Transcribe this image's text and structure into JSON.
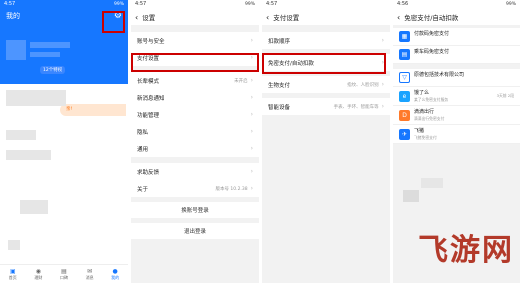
{
  "panel1": {
    "status_time": "4:57",
    "status_right": "99%",
    "title": "我的",
    "promo": "12个特权",
    "promo_badge": "亲!",
    "tabs": [
      "首页",
      "理财",
      "口碑",
      "消息",
      "我的"
    ]
  },
  "panel2": {
    "status_time": "4:57",
    "status_right": "99%",
    "title": "设置",
    "groups": [
      [
        {
          "label": "账号与安全",
          "value": ""
        },
        {
          "label": "支付设置",
          "value": ""
        }
      ],
      [
        {
          "label": "长辈模式",
          "value": "未开启"
        },
        {
          "label": "新消息通知",
          "value": ""
        },
        {
          "label": "功能管理",
          "value": ""
        },
        {
          "label": "隐私",
          "value": ""
        },
        {
          "label": "通用",
          "value": ""
        }
      ],
      [
        {
          "label": "求助反馈",
          "value": ""
        },
        {
          "label": "关于",
          "value": "版本号 10.2.38"
        }
      ]
    ],
    "switch_account": "换账号登录",
    "logout": "退出登录"
  },
  "panel3": {
    "status_time": "4:57",
    "title": "支付设置",
    "items": [
      {
        "label": "扣款顺序",
        "value": ""
      },
      {
        "label": "免密支付/自动扣款",
        "value": ""
      },
      {
        "label": "生物支付",
        "value": "指纹、人脸识别"
      },
      {
        "label": "智能设备",
        "value": "手表、手环、智能车等"
      }
    ]
  },
  "panel4": {
    "status_time": "4:56",
    "status_right": "99%",
    "title": "免密支付/自动扣款",
    "top_items": [
      {
        "title": "付款码免密支付",
        "sub": "",
        "color": "#1677ff"
      },
      {
        "title": "乘车码免密支付",
        "sub": "",
        "color": "#1677ff"
      }
    ],
    "apps": [
      {
        "title": "原德包括技术有限公司",
        "sub": "",
        "date": "",
        "color": "#1677ff"
      },
      {
        "title": "饿了么",
        "sub": "某了么免密支付服务",
        "date": "3天前 2段",
        "color": "#1aa3ff"
      },
      {
        "title": "滴滴出行",
        "sub": "滴滴出行免密支付",
        "date": "",
        "color": "#ff7a2a"
      },
      {
        "title": "飞猪",
        "sub": "飞猪免密支付",
        "date": "",
        "color": "#1677ff"
      }
    ]
  },
  "watermark": "飞游网"
}
